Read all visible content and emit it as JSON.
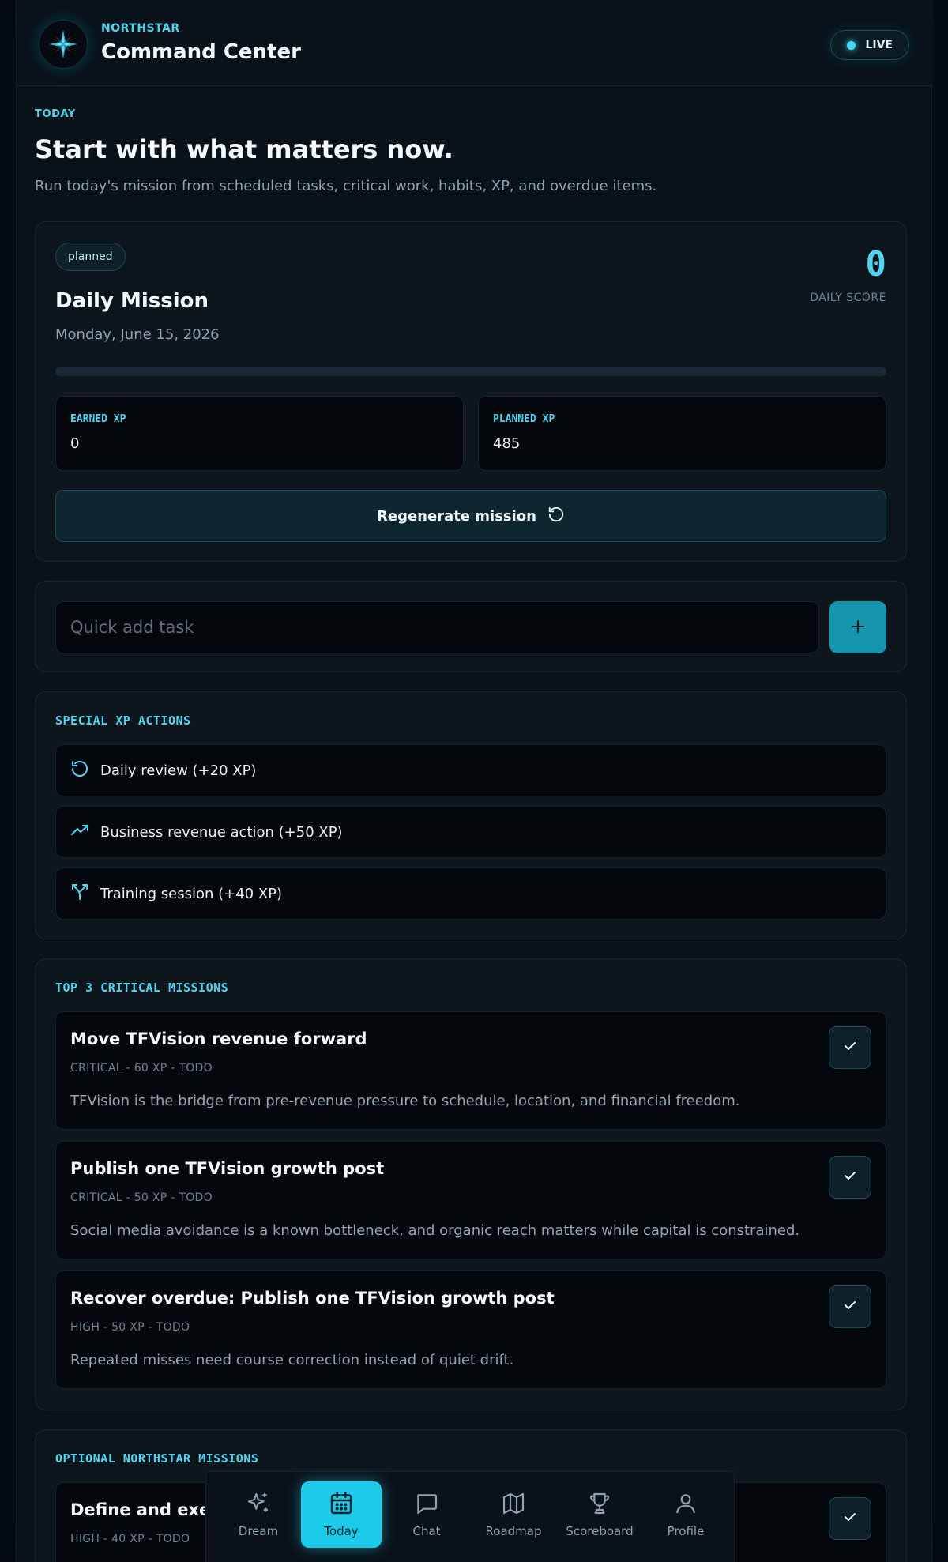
{
  "header": {
    "brand": "NORTHSTAR",
    "title": "Command Center",
    "live_label": "LIVE",
    "logo_icon": "compass-star-icon"
  },
  "intro": {
    "eyebrow": "TODAY",
    "title": "Start with what matters now.",
    "subtitle": "Run today's mission from scheduled tasks, critical work, habits, XP, and overdue items."
  },
  "mission": {
    "status": "planned",
    "title": "Daily Mission",
    "date": "Monday, June 15, 2026",
    "score": "0",
    "score_label": "DAILY SCORE",
    "progress_fraction": 0,
    "earned_label": "EARNED XP",
    "earned_value": "0",
    "planned_label": "PLANNED XP",
    "planned_value": "485",
    "regenerate_label": "Regenerate mission"
  },
  "quick_add": {
    "placeholder": "Quick add task",
    "value": ""
  },
  "special": {
    "title": "SPECIAL XP ACTIONS",
    "items": [
      {
        "label": "Daily review (+20 XP)",
        "icon": "refresh-icon"
      },
      {
        "label": "Business revenue action (+50 XP)",
        "icon": "trending-up-icon"
      },
      {
        "label": "Training session (+40 XP)",
        "icon": "split-arrows-icon"
      }
    ]
  },
  "critical": {
    "title": "TOP 3 CRITICAL MISSIONS",
    "items": [
      {
        "title": "Move TFVision revenue forward",
        "meta": "CRITICAL - 60 XP - TODO",
        "desc": "TFVision is the bridge from pre-revenue pressure to schedule, location, and financial freedom."
      },
      {
        "title": "Publish one TFVision growth post",
        "meta": "CRITICAL - 50 XP - TODO",
        "desc": "Social media avoidance is a known bottleneck, and organic reach matters while capital is constrained."
      },
      {
        "title": "Recover overdue: Publish one TFVision growth post",
        "meta": "HIGH - 50 XP - TODO",
        "desc": "Repeated misses need course correction instead of quiet drift."
      }
    ]
  },
  "optional": {
    "title": "OPTIONAL NORTHSTAR MISSIONS",
    "items": [
      {
        "title": "Define and execut",
        "meta": "HIGH - 40 XP - TODO"
      }
    ]
  },
  "nav": {
    "items": [
      {
        "label": "Dream",
        "icon": "sparkles-icon"
      },
      {
        "label": "Today",
        "icon": "calendar-icon"
      },
      {
        "label": "Chat",
        "icon": "chat-bubble-icon"
      },
      {
        "label": "Roadmap",
        "icon": "map-icon"
      },
      {
        "label": "Scoreboard",
        "icon": "trophy-icon"
      },
      {
        "label": "Profile",
        "icon": "user-icon"
      }
    ],
    "active": "Today"
  },
  "colors": {
    "accent": "#4fd6ee",
    "background": "#0a1219",
    "nav_active": "#1ccbea"
  }
}
